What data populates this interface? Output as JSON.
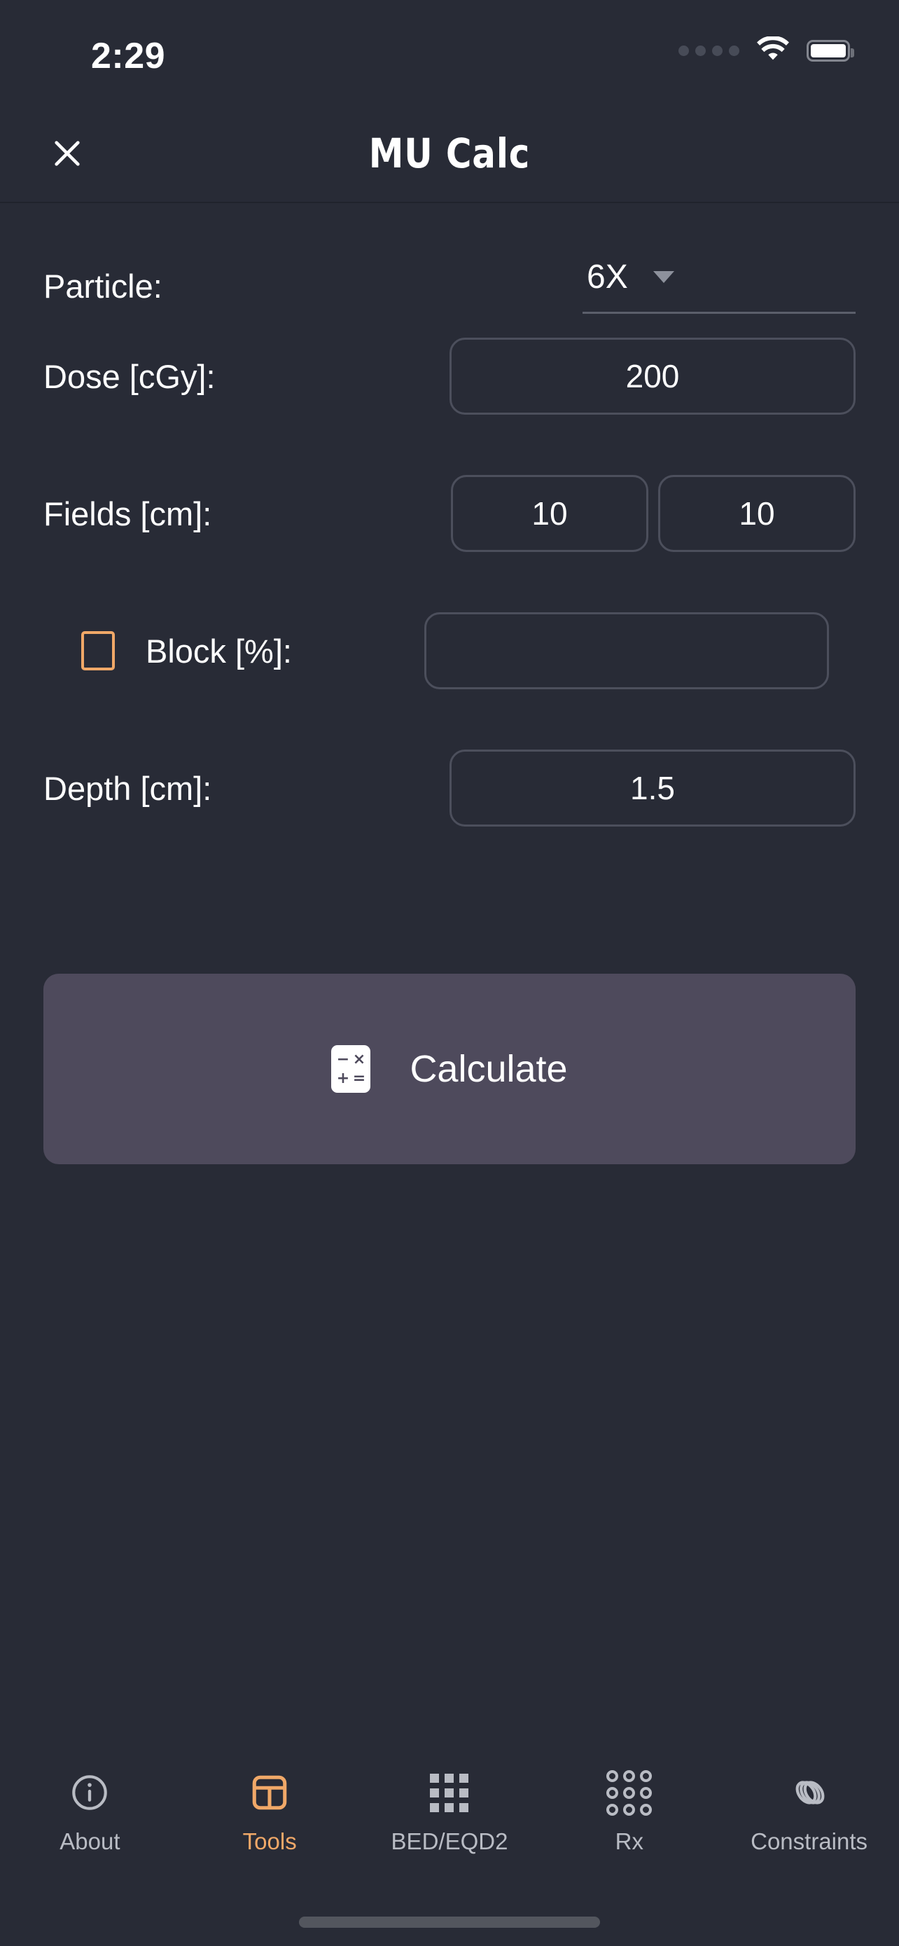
{
  "status_bar": {
    "time": "2:29",
    "cellular_icon": "cellular-dots-icon",
    "wifi_icon": "wifi-icon",
    "battery_icon": "battery-full-icon"
  },
  "header": {
    "title": "MU Calc",
    "close_icon": "close-x-icon"
  },
  "form": {
    "particle": {
      "label": "Particle:",
      "value": "6X",
      "caret_icon": "chevron-down-icon",
      "options": [
        "6X"
      ]
    },
    "dose": {
      "label": "Dose [cGy]:",
      "value": "200",
      "placeholder": ""
    },
    "fields": {
      "label": "Fields [cm]:",
      "value_x": "10",
      "value_y": "10",
      "placeholder": ""
    },
    "block": {
      "label": "Block [%]:",
      "checked": false,
      "value": "",
      "placeholder": "",
      "checkbox_color": "#f0a868"
    },
    "depth": {
      "label": "Depth [cm]:",
      "value": "1.5",
      "placeholder": ""
    },
    "calculate": {
      "label": "Calculate",
      "icon": "calculator-icon",
      "icon_glyphs": [
        "−",
        "×",
        "+",
        "="
      ],
      "button_color": "#4e4a5c"
    }
  },
  "tabbar": {
    "active": "Tools",
    "accent_color": "#f0a868",
    "inactive_color": "#b9bcc4",
    "items": [
      {
        "label": "About",
        "icon": "info-circle-icon"
      },
      {
        "label": "Tools",
        "icon": "layout-dashboard-icon"
      },
      {
        "label": "BED/EQD2",
        "icon": "grid-squares-icon"
      },
      {
        "label": "Rx",
        "icon": "grid-rings-icon"
      },
      {
        "label": "Constraints",
        "icon": "overlapping-rings-icon"
      }
    ]
  },
  "home_indicator": {
    "name": "home-indicator-bar"
  },
  "theme": {
    "background": "#282b36",
    "text": "#ffffff",
    "border": "#4c4f5c",
    "accent": "#f0a868"
  }
}
